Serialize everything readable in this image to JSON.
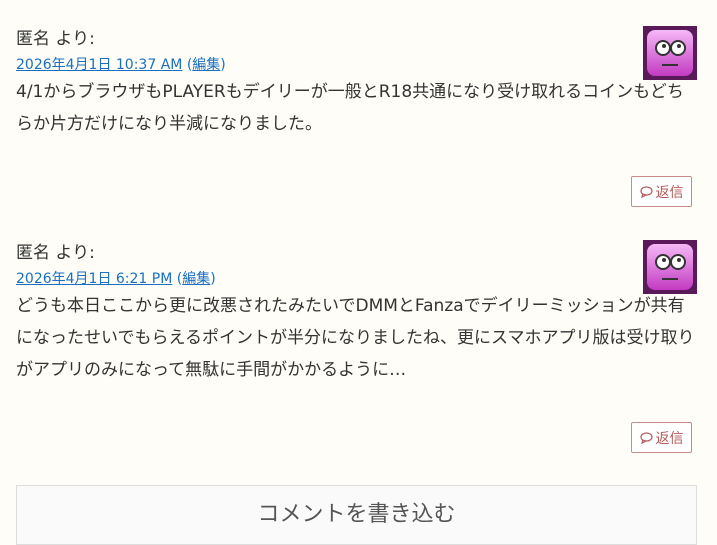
{
  "comments": [
    {
      "author": "匿名 より:",
      "date": "2026年4月1日 10:37 AM",
      "edit_open": "(",
      "edit_label": "編集",
      "edit_close": ")",
      "text": "4/1からブラウザもPLAYERもデイリーが一般とR18共通になり受け取れるコインもどちらか片方だけになり半減になりました。",
      "reply_label": "返信",
      "avatar_icon": "robot-face-avatar"
    },
    {
      "author": "匿名 より:",
      "date": "2026年4月1日 6:21 PM",
      "edit_open": "(",
      "edit_label": "編集",
      "edit_close": ")",
      "text": "どうも本日ここから更に改悪されたみたいでDMMとFanzaでデイリーミッションが共有になったせいでもらえるポイントが半分になりましたね、更にスマホアプリ版は受け取りがアプリのみになって無駄に手間がかかるように…",
      "reply_label": "返信",
      "avatar_icon": "robot-face-avatar"
    }
  ],
  "write_comment": {
    "title": "コメントを書き込む"
  },
  "colors": {
    "link": "#1a6fc0",
    "reply_border": "#c98a8a",
    "avatar": "#d54fd5"
  }
}
